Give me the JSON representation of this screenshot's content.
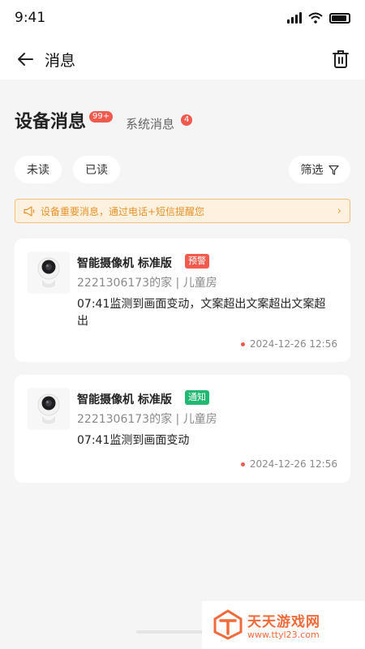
{
  "status_bar": {
    "time": "9:41"
  },
  "nav": {
    "title": "消息"
  },
  "tabs": {
    "active": {
      "label": "设备消息",
      "badge": "99+"
    },
    "inactive": {
      "label": "系统消息",
      "badge": "4"
    }
  },
  "filters": {
    "unread": "未读",
    "read": "已读",
    "filter": "筛选"
  },
  "notice": {
    "text": "设备重要消息，通过电话+短信提醒您"
  },
  "messages": [
    {
      "device": "智能摄像机 标准版",
      "tag": "预警",
      "location": "2221306173的家 | 儿童房",
      "content": "07:41监测到画面变动，文案超出文案超出文案超出",
      "time": "2024-12-26 12:56",
      "unread": true
    },
    {
      "device": "智能摄像机 标准版",
      "tag": "通知",
      "location": "2221306173的家 | 儿童房",
      "content": "07:41监测到画面变动",
      "time": "2024-12-26 12:56",
      "unread": true
    }
  ],
  "watermark": {
    "title": "天天游戏网",
    "url": "www.ttyl23.com"
  },
  "colors": {
    "accent_red": "#f25a4e",
    "accent_green": "#21b871",
    "notice_orange": "#e6922a"
  }
}
